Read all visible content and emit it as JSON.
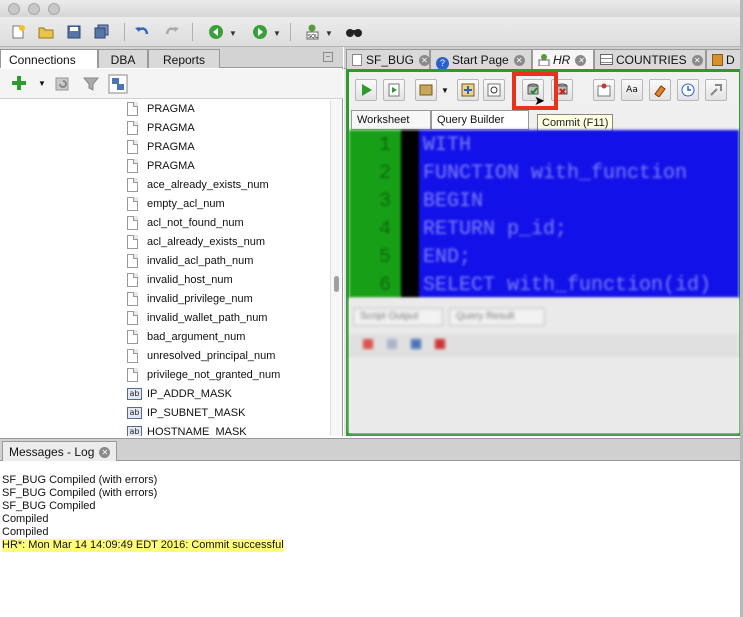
{
  "toolbar": {
    "icons": [
      "new-file-icon",
      "open-icon",
      "save-icon",
      "save-all-icon",
      "undo-icon",
      "redo-icon",
      "back-icon",
      "forward-icon",
      "sql-worksheet-icon",
      "find-icon"
    ]
  },
  "left_panel": {
    "tabs": [
      {
        "label": "Connections"
      },
      {
        "label": "DBA"
      },
      {
        "label": "Reports"
      }
    ],
    "tree_items": [
      {
        "label": "PRAGMA",
        "icon": "document-icon"
      },
      {
        "label": "PRAGMA",
        "icon": "document-icon"
      },
      {
        "label": "PRAGMA",
        "icon": "document-icon"
      },
      {
        "label": "PRAGMA",
        "icon": "document-icon"
      },
      {
        "label": "ace_already_exists_num",
        "icon": "document-icon"
      },
      {
        "label": "empty_acl_num",
        "icon": "document-icon"
      },
      {
        "label": "acl_not_found_num",
        "icon": "document-icon"
      },
      {
        "label": "acl_already_exists_num",
        "icon": "document-icon"
      },
      {
        "label": "invalid_acl_path_num",
        "icon": "document-icon"
      },
      {
        "label": "invalid_host_num",
        "icon": "document-icon"
      },
      {
        "label": "invalid_privilege_num",
        "icon": "document-icon"
      },
      {
        "label": "invalid_wallet_path_num",
        "icon": "document-icon"
      },
      {
        "label": "bad_argument_num",
        "icon": "document-icon"
      },
      {
        "label": "unresolved_principal_num",
        "icon": "document-icon"
      },
      {
        "label": "privilege_not_granted_num",
        "icon": "document-icon"
      },
      {
        "label": "IP_ADDR_MASK",
        "icon": "ab-variable-icon"
      },
      {
        "label": "IP_SUBNET_MASK",
        "icon": "ab-variable-icon"
      },
      {
        "label": "HOSTNAME_MASK",
        "icon": "ab-variable-icon"
      }
    ]
  },
  "editor": {
    "tabs": [
      {
        "label": "SF_BUG"
      },
      {
        "label": "Start Page"
      },
      {
        "label": "HR"
      },
      {
        "label": "COUNTRIES"
      },
      {
        "label": "D"
      }
    ],
    "subtabs": [
      {
        "label": "Worksheet"
      },
      {
        "label": "Query Builder"
      }
    ],
    "tooltip": "Commit (F11)",
    "code_lines": [
      {
        "no": "1",
        "text": "WITH"
      },
      {
        "no": "2",
        "text": "  FUNCTION with_function"
      },
      {
        "no": "3",
        "text": "  BEGIN"
      },
      {
        "no": "4",
        "text": "    RETURN p_id;"
      },
      {
        "no": "5",
        "text": "  END;"
      },
      {
        "no": "6",
        "text": "SELECT with_function(id)"
      }
    ],
    "output_tabs": [
      {
        "label": "Script Output"
      },
      {
        "label": "Query Result"
      }
    ]
  },
  "messages": {
    "tab_label": "Messages - Log",
    "lines": [
      {
        "text": "SF_BUG Compiled (with errors)",
        "highlight": false
      },
      {
        "text": "SF_BUG Compiled (with errors)",
        "highlight": false
      },
      {
        "text": "SF_BUG Compiled",
        "highlight": false
      },
      {
        "text": "Compiled",
        "highlight": false
      },
      {
        "text": "Compiled",
        "highlight": false
      },
      {
        "text": "HR*: Mon Mar 14 14:09:49 EDT 2016: Commit successful",
        "highlight": true
      }
    ]
  },
  "colors": {
    "editor_border": "#2e9a2e",
    "code_background": "#1212e8",
    "gutter": "#17a017",
    "highlight_box": "#e8321c",
    "log_highlight": "#ffff7a"
  }
}
